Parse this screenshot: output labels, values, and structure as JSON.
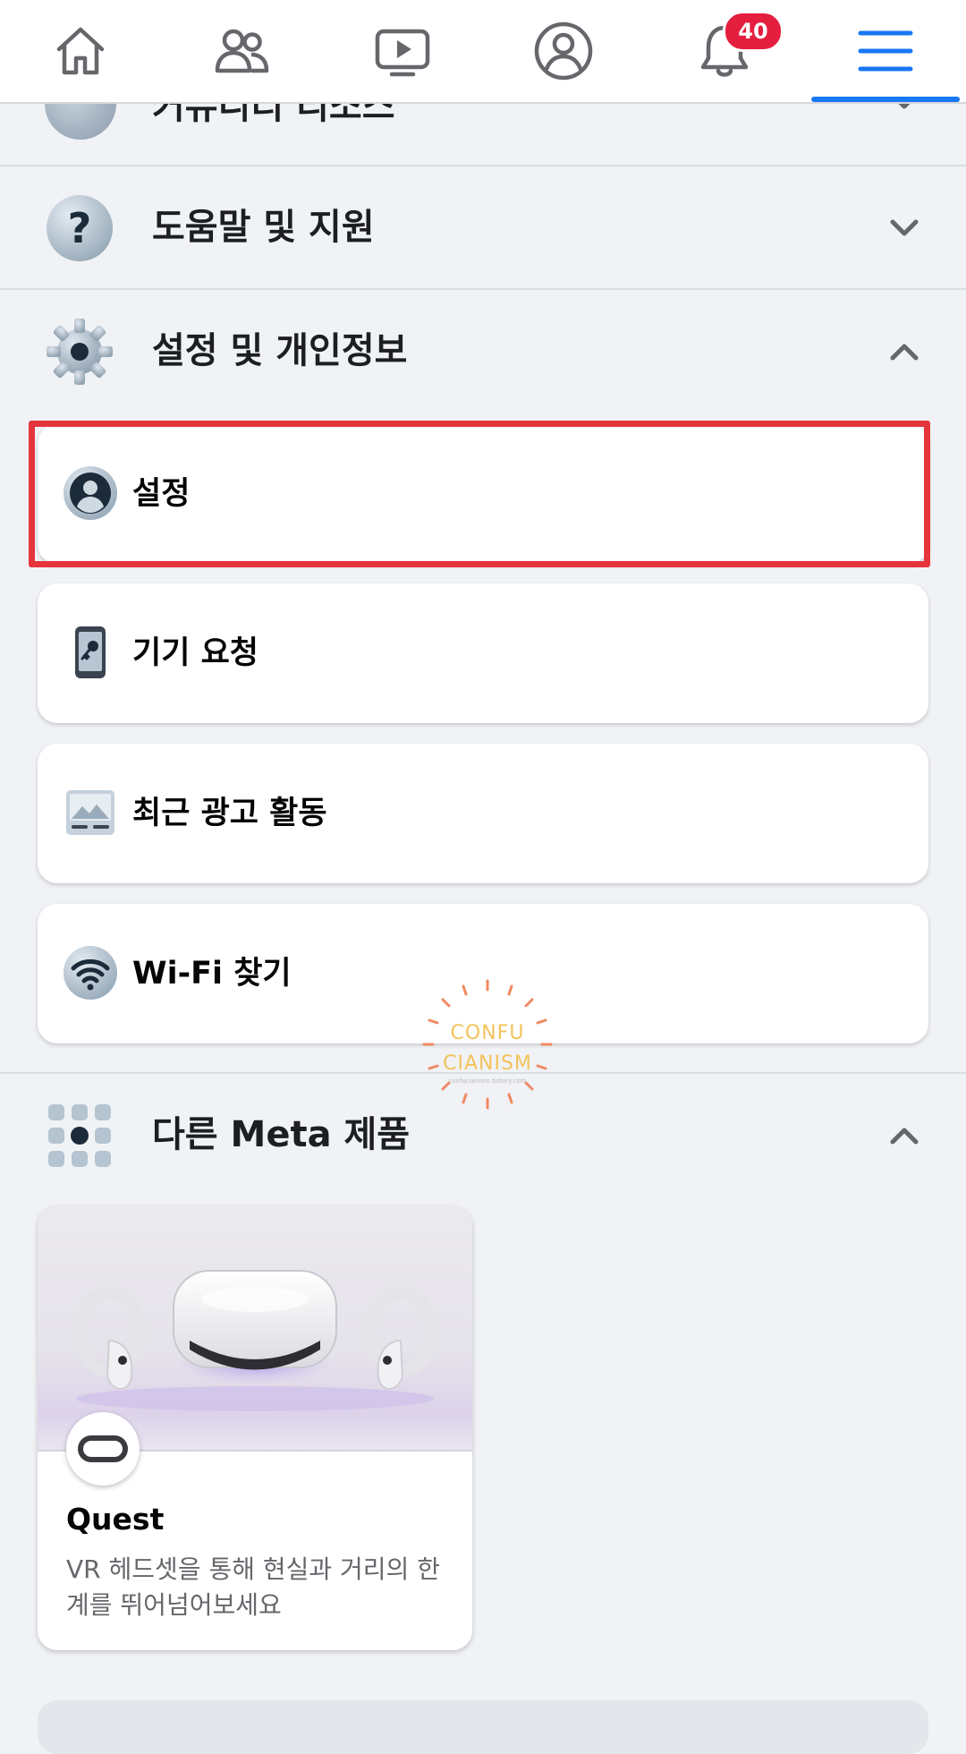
{
  "top_nav": {
    "items": [
      {
        "icon": "home-icon"
      },
      {
        "icon": "friends-icon"
      },
      {
        "icon": "watch-icon"
      },
      {
        "icon": "profile-icon"
      },
      {
        "icon": "notifications-icon",
        "badge": "40"
      },
      {
        "icon": "menu-icon",
        "active": true
      }
    ],
    "notification_count": "40",
    "accent_color": "#1877f2",
    "badge_color": "#e41e3f"
  },
  "menu": {
    "partial_section_label": "커뮤니티 리소스",
    "help_section": {
      "label": "도움말 및 지원",
      "icon": "question-icon",
      "expanded": false
    },
    "settings_section": {
      "label": "설정 및 개인정보",
      "icon": "gear-icon",
      "expanded": true,
      "items": [
        {
          "label": "설정",
          "icon": "profile-settings-icon",
          "highlighted": true
        },
        {
          "label": "기기 요청",
          "icon": "phone-key-icon"
        },
        {
          "label": "최근 광고 활동",
          "icon": "ad-activity-icon"
        },
        {
          "label": "Wi-Fi 찾기",
          "icon": "wifi-icon"
        }
      ]
    },
    "meta_section": {
      "label": "다른 Meta 제품",
      "icon": "apps-grid-icon",
      "expanded": true
    },
    "product": {
      "title": "Quest",
      "description": "VR 헤드셋을 통해 현실과 거리의 한계를 뛰어넘어보세요",
      "icon": "quest-icon"
    }
  },
  "watermark": {
    "line1": "CONFU",
    "line2": "CIANISM",
    "small": "confucianism.tistory.com"
  },
  "highlight_color": "#e5343c"
}
